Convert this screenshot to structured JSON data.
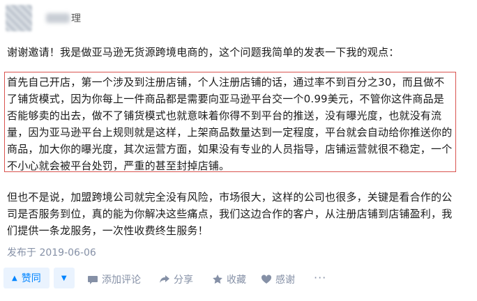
{
  "author": {
    "name_suffix": "理"
  },
  "intro": "谢谢邀请！我是做亚马逊无货源跨境电商的，这个问题我简单的发表一下我的观点：",
  "highlighted": "首先自己开店，第一个涉及到注册店铺，个人注册店铺的话，通过率不到百分之30，而且做不了铺货模式，因为你每上一件商品都是需要向亚马逊平台交一个0.99美元，不管你这件商品是否能够卖的出去，做不了铺货模式也就意味着你得不到平台的推送，没有曝光度，也就没有流量，因为亚马逊平台上规则就是这样，上架商品数量达到一定程度，平台就会自动给你推送你的商品，加大你的曝光度，其次运营方面，如果没有专业的人员指导，店铺运营就很不稳定，一个不小心就会被平台处罚，严重的甚至封掉店铺。",
  "closing": "但也不是说，加盟跨境公司就完全没有风险，市场很大，这样的公司也很多，关键是看合作的公司是否服务到位，真的能为你解决这些痛点，我们这边合作的客户，从注册店铺到店铺盈利，我们提供一条龙服务，一次性收费终生服务！",
  "published": "发布于 2019-06-06",
  "actions": {
    "vote_up": "赞同",
    "comment": "添加评论",
    "share": "分享",
    "favorite": "收藏",
    "thanks": "感谢",
    "more": "···"
  },
  "colors": {
    "accent": "#0084ff",
    "highlight_border": "#d9534f",
    "meta": "#8590a6"
  },
  "icons": [
    "vote-up-icon",
    "vote-down-icon",
    "comment-icon",
    "share-icon",
    "star-icon",
    "heart-icon"
  ]
}
